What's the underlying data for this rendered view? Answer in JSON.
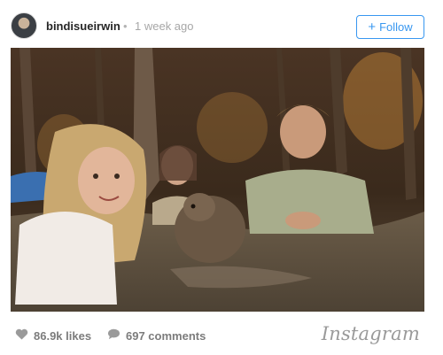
{
  "post": {
    "username": "bindisueirwin",
    "separator": "•",
    "time_ago": "1 week ago",
    "follow_label": "Follow",
    "follow_icon": "plus-icon"
  },
  "stats": {
    "likes": "86.9k likes",
    "comments": "697 comments",
    "like_icon": "heart-icon",
    "comment_icon": "speech-bubble-icon"
  },
  "brand": {
    "name": "Instagram"
  },
  "colors": {
    "accent": "#3897f0",
    "muted": "#7c7c7c"
  }
}
